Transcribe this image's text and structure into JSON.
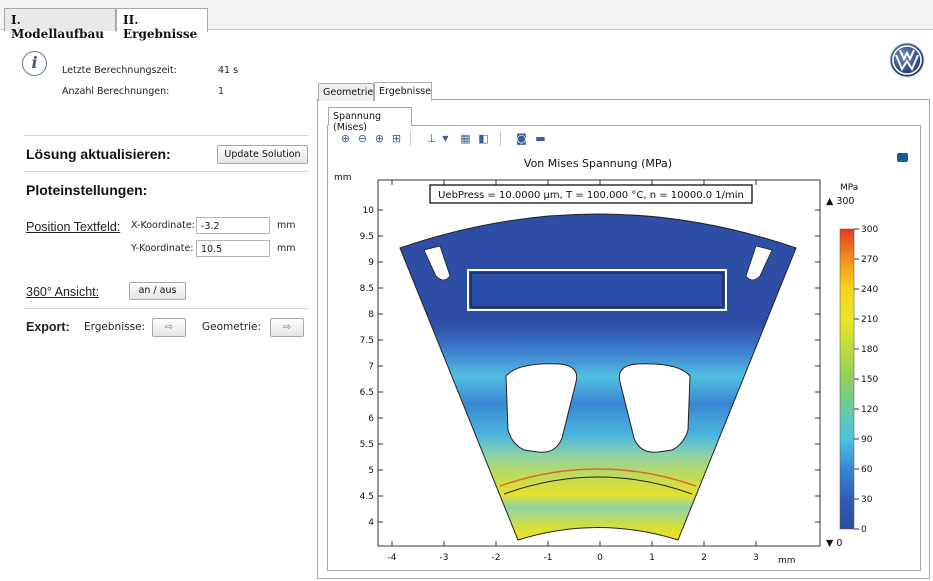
{
  "tabs": {
    "tab1": "I. Modellaufbau",
    "tab2": "II. Ergebnisse"
  },
  "info": {
    "time_label": "Letzte Berechnungszeit:",
    "time_value": "41 s",
    "count_label": "Anzahl Berechnungen:",
    "count_value": "1"
  },
  "solution": {
    "heading": "Lösung aktualisieren:",
    "button": "Update Solution"
  },
  "plot_settings": {
    "heading": "Ploteinstellungen:",
    "position_label": "Position Textfeld:",
    "x_label": "X-Koordinate:",
    "x_value": "-3.2",
    "x_unit": "mm",
    "y_label": "Y-Koordinate:",
    "y_value": "10.5",
    "y_unit": "mm",
    "view_label": "360° Ansicht:",
    "view_button": "an / aus"
  },
  "export": {
    "heading": "Export:",
    "results_label": "Ergebnisse:",
    "geometry_label": "Geometrie:"
  },
  "view_tabs": {
    "geometry": "Geometrie",
    "results": "Ergebnisse",
    "inner": "Spannung (Mises)"
  },
  "plot": {
    "title": "Von Mises Spannung (MPa)",
    "annotation": "UebPress = 10.0000 µm, T = 100.000 °C, n = 10000.0  1/min",
    "y_unit": "mm",
    "x_unit": "mm",
    "x_ticks": [
      "-4",
      "-3",
      "-2",
      "-1",
      "0",
      "1",
      "2",
      "3"
    ],
    "y_ticks": [
      "10",
      "9.5",
      "9",
      "8.5",
      "8",
      "7.5",
      "7",
      "6.5",
      "6",
      "5.5",
      "5",
      "4.5",
      "4"
    ],
    "colorbar_unit": "MPa",
    "colorbar_max": "▲ 300",
    "colorbar_min": "▼ 0",
    "colorbar_ticks": [
      "300",
      "270",
      "240",
      "210",
      "180",
      "150",
      "120",
      "90",
      "60",
      "30",
      "0"
    ]
  },
  "colors": {
    "low": "#2c4b9e",
    "mid": "#4fc3e3",
    "high": "#f2e11a",
    "max": "#e23a1e"
  }
}
